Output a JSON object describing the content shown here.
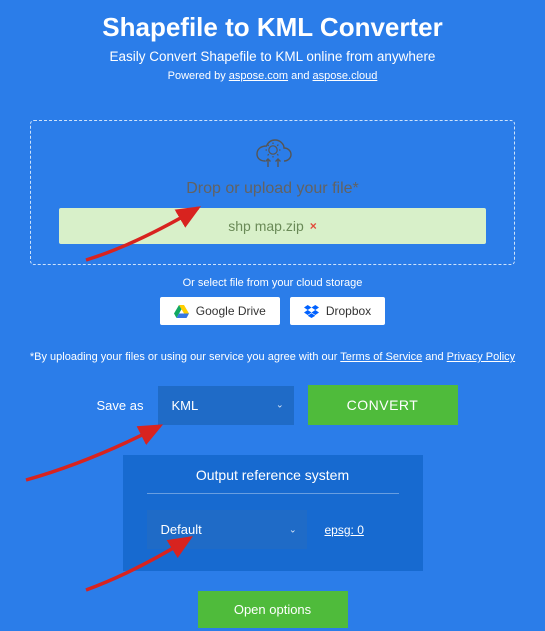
{
  "header": {
    "title": "Shapefile to KML Converter",
    "subtitle": "Easily Convert Shapefile to KML online from anywhere",
    "powered_prefix": "Powered by ",
    "powered_link1": "aspose.com",
    "powered_and": " and ",
    "powered_link2": "aspose.cloud"
  },
  "drop": {
    "label": "Drop or upload your file*",
    "filename": "shp map.zip",
    "remove": "×"
  },
  "cloud": {
    "hint": "Or select file from your cloud storage",
    "gdrive": "Google Drive",
    "dropbox": "Dropbox"
  },
  "terms": {
    "prefix": "*By uploading your files or using our service you agree with our ",
    "tos": "Terms of Service",
    "and": " and ",
    "privacy": "Privacy Policy"
  },
  "saveas": {
    "label": "Save as",
    "value": "KML",
    "convert": "CONVERT"
  },
  "output": {
    "title": "Output reference system",
    "value": "Default",
    "epsg": "epsg: 0"
  },
  "open_options": "Open options"
}
